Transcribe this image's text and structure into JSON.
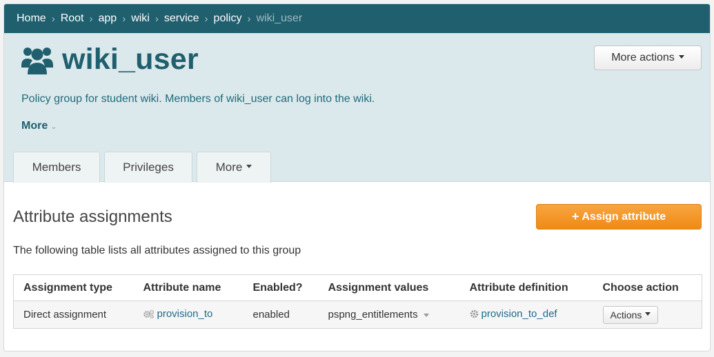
{
  "breadcrumb": {
    "items": [
      "Home",
      "Root",
      "app",
      "wiki",
      "service",
      "policy"
    ],
    "current": "wiki_user",
    "separator": "›"
  },
  "header": {
    "title": "wiki_user",
    "icon": "users-icon",
    "more_actions_label": "More actions",
    "description": "Policy group for student wiki. Members of wiki_user can log into the wiki.",
    "more_label": "More"
  },
  "tabs": [
    {
      "label": "Members"
    },
    {
      "label": "Privileges"
    },
    {
      "label": "More"
    }
  ],
  "section": {
    "title": "Attribute assignments",
    "assign_button": "Assign attribute",
    "description": "The following table lists all attributes assigned to this group"
  },
  "table": {
    "columns": [
      "Assignment type",
      "Attribute name",
      "Enabled?",
      "Assignment values",
      "Attribute definition",
      "Choose action"
    ],
    "rows": [
      {
        "assignment_type": "Direct assignment",
        "attribute_name": "provision_to",
        "enabled": "enabled",
        "assignment_values": "pspng_entitlements",
        "attribute_definition": "provision_to_def",
        "action_label": "Actions"
      }
    ]
  },
  "colors": {
    "brand_dark": "#1f5f6e",
    "header_bg": "#dce9ec",
    "accent_orange": "#f29a2e",
    "link": "#1f6a8a"
  }
}
